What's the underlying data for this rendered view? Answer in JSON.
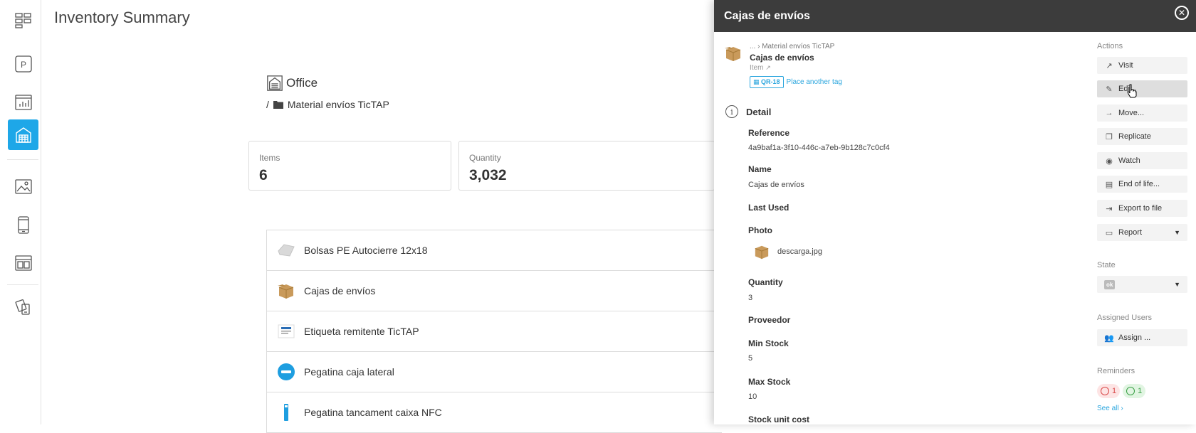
{
  "sidebar": {
    "items": [
      {
        "icon": "dashboard-icon"
      },
      {
        "icon": "parking-icon",
        "label": "P"
      },
      {
        "icon": "chart-icon"
      },
      {
        "icon": "warehouse-icon",
        "active": true
      },
      {
        "icon": "image-icon"
      },
      {
        "icon": "mobile-icon"
      },
      {
        "icon": "layout-icon"
      },
      {
        "icon": "devices-icon"
      }
    ],
    "active_color": "#1ea7e8"
  },
  "main": {
    "title": "Inventory Summary",
    "location": {
      "name": "Office"
    },
    "breadcrumb": {
      "separator": "/",
      "folder": "Material envíos TicTAP"
    },
    "stats": [
      {
        "label": "Items",
        "value": "6"
      },
      {
        "label": "Quantity",
        "value": "3,032"
      }
    ],
    "items": [
      {
        "name": "Bolsas PE Autocierre 12x18"
      },
      {
        "name": "Cajas de envíos"
      },
      {
        "name": "Etiqueta remitente TicTAP"
      },
      {
        "name": "Pegatina caja lateral"
      },
      {
        "name": "Pegatina tancament caixa NFC"
      }
    ]
  },
  "panel": {
    "title": "Cajas de envíos",
    "header_color": "#3c3c3c",
    "item": {
      "path": "... › Material envíos TicTAP",
      "name": "Cajas de envíos",
      "type": "Item",
      "tag": "QR-18",
      "place_tag": "Place another tag"
    },
    "detail_title": "Detail",
    "fields": {
      "reference_label": "Reference",
      "reference_value": "4a9baf1a-3f10-446c-a7eb-9b128c7c0cf4",
      "name_label": "Name",
      "name_value": "Cajas de envíos",
      "last_used_label": "Last Used",
      "photo_label": "Photo",
      "photo_file": "descarga.jpg",
      "quantity_label": "Quantity",
      "quantity_value": "3",
      "proveedor_label": "Proveedor",
      "min_stock_label": "Min Stock",
      "min_stock_value": "5",
      "max_stock_label": "Max Stock",
      "max_stock_value": "10",
      "stock_unit_cost_label": "Stock unit cost"
    },
    "actions": {
      "title": "Actions",
      "buttons": [
        "Visit",
        "Edit",
        "Move...",
        "Replicate",
        "Watch",
        "End of life...",
        "Export to file",
        "Report"
      ]
    },
    "state": {
      "title": "State",
      "value": "ok"
    },
    "assigned_users": {
      "title": "Assigned Users",
      "button": "Assign ..."
    },
    "reminders": {
      "title": "Reminders",
      "overdue": "1",
      "upcoming": "1",
      "see_all": "See all"
    },
    "link_color": "#2ba6de"
  }
}
